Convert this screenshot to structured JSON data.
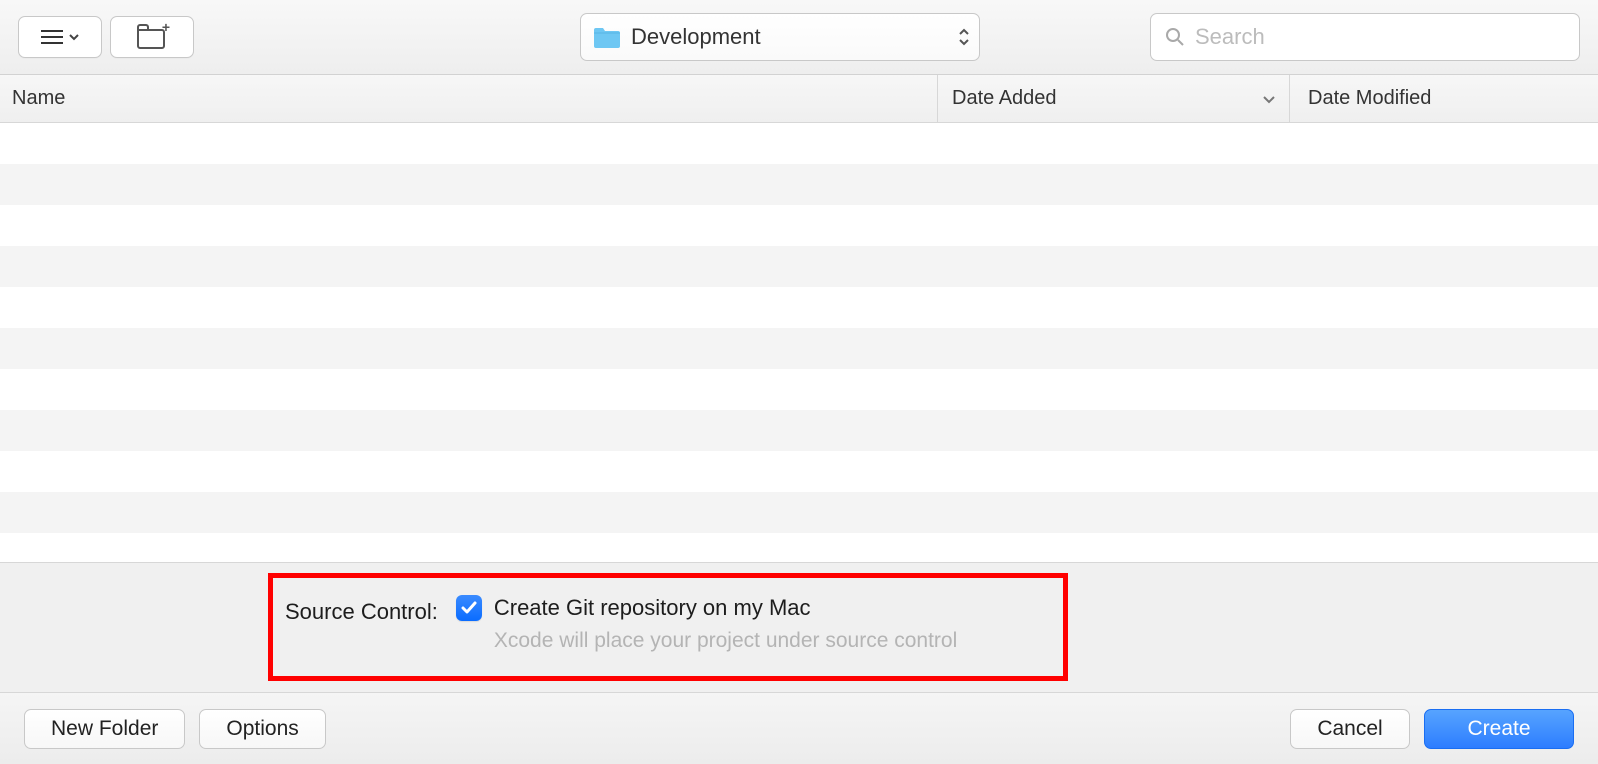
{
  "toolbar": {
    "view_icon": "list-view-icon",
    "new_folder_icon": "new-folder-icon"
  },
  "location": {
    "folder_name": "Development"
  },
  "search": {
    "placeholder": "Search"
  },
  "columns": {
    "name": "Name",
    "date_added": "Date Added",
    "date_modified": "Date Modified"
  },
  "source_control": {
    "label": "Source Control:",
    "checkbox_label": "Create Git repository on my Mac",
    "checked": true,
    "hint": "Xcode will place your project under source control"
  },
  "buttons": {
    "new_folder": "New Folder",
    "options": "Options",
    "cancel": "Cancel",
    "create": "Create"
  }
}
